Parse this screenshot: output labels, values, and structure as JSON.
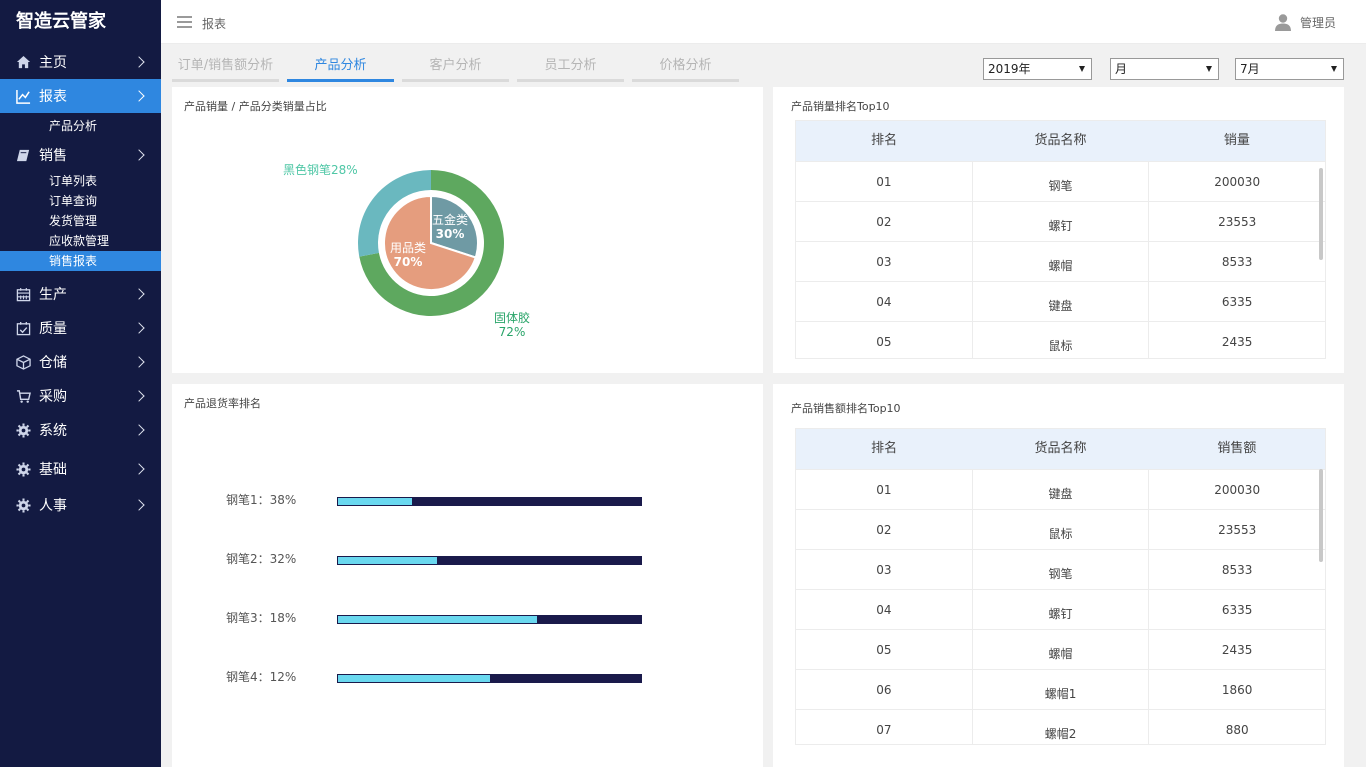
{
  "brand": "智造云管家",
  "sidebar": {
    "items": [
      {
        "label": "主页",
        "icon": "home-icon"
      },
      {
        "label": "报表",
        "icon": "chart-icon"
      },
      {
        "label": "销售",
        "icon": "book-icon"
      },
      {
        "label": "生产",
        "icon": "calendar-icon"
      },
      {
        "label": "质量",
        "icon": "calendar-check-icon"
      },
      {
        "label": "仓储",
        "icon": "cube-icon"
      },
      {
        "label": "采购",
        "icon": "cart-icon"
      },
      {
        "label": "系统",
        "icon": "gear-icon"
      },
      {
        "label": "基础",
        "icon": "gear-icon"
      },
      {
        "label": "人事",
        "icon": "gear-icon"
      }
    ],
    "report_sub": [
      "产品分析"
    ],
    "sales_sub": [
      "订单列表",
      "订单查询",
      "发货管理",
      "应收款管理",
      "销售报表"
    ]
  },
  "topbar": {
    "breadcrumb": "报表",
    "user": "管理员"
  },
  "tabs": [
    "订单/销售额分析",
    "产品分析",
    "客户分析",
    "员工分析",
    "价格分析"
  ],
  "filters": {
    "year": "2019年",
    "period": "月",
    "month": "7月"
  },
  "donut_panel": {
    "title": "产品销量 / 产品分类销量占比",
    "outer": [
      {
        "label": "黑色钢笔",
        "pct": "28%",
        "value": 28,
        "color": "#6ab8bf"
      },
      {
        "label": "固体胶",
        "pct": "72%",
        "value": 72,
        "color": "#5ea85f"
      }
    ],
    "inner": [
      {
        "label": "五金类",
        "pct": "30%",
        "value": 30,
        "color": "#6f9aa4"
      },
      {
        "label": "用品类",
        "pct": "70%",
        "value": 70,
        "color": "#e59d7e"
      }
    ]
  },
  "top10_sales": {
    "title": "产品销量排名Top10",
    "headers": [
      "排名",
      "货品名称",
      "销量"
    ],
    "rows": [
      [
        "01",
        "钢笔",
        "200030"
      ],
      [
        "02",
        "螺钉",
        "23553"
      ],
      [
        "03",
        "螺帽",
        "8533"
      ],
      [
        "04",
        "键盘",
        "6335"
      ],
      [
        "05",
        "鼠标",
        "2435"
      ]
    ]
  },
  "return_rate": {
    "title": "产品退货率排名",
    "items": [
      {
        "label": "钢笔1：38%",
        "fill": 0.25
      },
      {
        "label": "钢笔2：32%",
        "fill": 0.33
      },
      {
        "label": "钢笔3：18%",
        "fill": 0.66
      },
      {
        "label": "钢笔4：12%",
        "fill": 0.505
      }
    ]
  },
  "top10_revenue": {
    "title": "产品销售额排名Top10",
    "headers": [
      "排名",
      "货品名称",
      "销售额"
    ],
    "rows": [
      [
        "01",
        "键盘",
        "200030"
      ],
      [
        "02",
        "鼠标",
        "23553"
      ],
      [
        "03",
        "钢笔",
        "8533"
      ],
      [
        "04",
        "螺钉",
        "6335"
      ],
      [
        "05",
        "螺帽",
        "2435"
      ],
      [
        "06",
        "螺帽1",
        "1860"
      ],
      [
        "07",
        "螺帽2",
        "880"
      ]
    ]
  }
}
